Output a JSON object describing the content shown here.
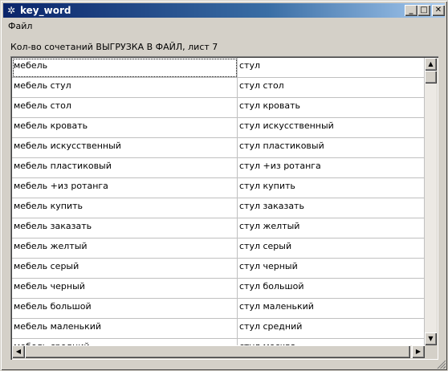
{
  "window": {
    "title": "key_word",
    "icon": "gear-icon",
    "minimize_glyph": "_",
    "maximize_glyph": "□",
    "close_glyph": "✕"
  },
  "menu": {
    "file_label": "Файл"
  },
  "caption": "Кол-во сочетаний ВЫГРУЗКА В ФАЙЛ, лист 7",
  "table": {
    "rows": [
      [
        "мебель",
        "стул"
      ],
      [
        "мебель стул",
        "стул стол"
      ],
      [
        "мебель стол",
        "стул кровать"
      ],
      [
        "мебель кровать",
        "стул искусственный"
      ],
      [
        "мебель искусственный",
        "стул пластиковый"
      ],
      [
        "мебель пластиковый",
        "стул +из ротанга"
      ],
      [
        "мебель +из ротанга",
        "стул купить"
      ],
      [
        "мебель купить",
        "стул заказать"
      ],
      [
        "мебель заказать",
        "стул желтый"
      ],
      [
        "мебель желтый",
        "стул серый"
      ],
      [
        "мебель серый",
        "стул черный"
      ],
      [
        "мебель черный",
        "стул большой"
      ],
      [
        "мебель большой",
        "стул маленький"
      ],
      [
        "мебель маленький",
        "стул средний"
      ],
      [
        "мебель средний",
        "стул москва"
      ]
    ]
  },
  "scrollbars": {
    "up_glyph": "▲",
    "down_glyph": "▼",
    "left_glyph": "◀",
    "right_glyph": "▶"
  }
}
